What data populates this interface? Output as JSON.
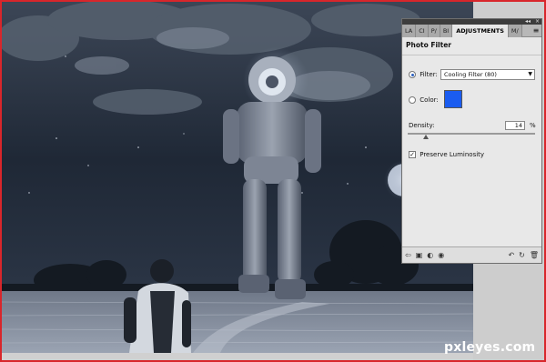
{
  "panel": {
    "tabs": [
      "LA",
      "CI",
      "P/",
      "BI",
      "ADJUSTMENTS",
      "M/"
    ],
    "title": "Photo Filter",
    "filter_label": "Filter:",
    "filter_value": "Cooling Filter (80)",
    "color_label": "Color:",
    "color_swatch": "#1a5cf0",
    "density_label": "Density:",
    "density_value": "14",
    "density_unit": "%",
    "density_level": 0.14,
    "preserve_luminosity_label": "Preserve Luminosity",
    "preserve_luminosity_checked": true,
    "bottom_icons": [
      "back-icon",
      "clip-layer-icon",
      "visibility-toggle-icon",
      "eye-icon",
      "view-previous-icon",
      "reset-icon",
      "delete-icon"
    ]
  },
  "watermark": "pxleyes.com",
  "colors": {
    "frame": "#d8262b",
    "sky": "#2b3442",
    "panel_bg": "#e8e8e8"
  }
}
